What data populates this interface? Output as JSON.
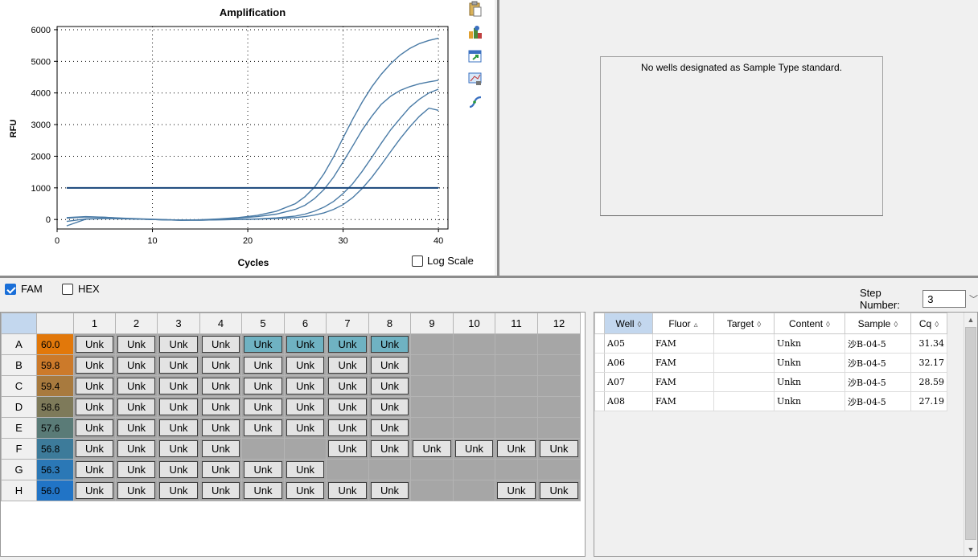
{
  "chart_data": {
    "type": "line",
    "title": "Amplification",
    "xlabel": "Cycles",
    "ylabel": "RFU",
    "xlim": [
      0,
      41
    ],
    "ylim": [
      -300,
      6100
    ],
    "xticks": [
      0,
      10,
      20,
      30,
      40
    ],
    "yticks": [
      0,
      1000,
      2000,
      3000,
      4000,
      5000,
      6000
    ],
    "threshold": 1000,
    "grid": "dotted",
    "x": [
      1,
      3,
      5,
      7,
      9,
      11,
      13,
      15,
      17,
      19,
      21,
      23,
      25,
      26,
      27,
      28,
      29,
      30,
      31,
      32,
      33,
      34,
      35,
      36,
      37,
      38,
      39,
      40
    ],
    "series": [
      {
        "well": "A05",
        "values": [
          -60,
          20,
          40,
          30,
          10,
          -10,
          -20,
          -20,
          -10,
          0,
          20,
          50,
          110,
          170,
          260,
          390,
          570,
          820,
          1130,
          1520,
          1960,
          2410,
          2840,
          3200,
          3550,
          3800,
          4000,
          4120
        ]
      },
      {
        "well": "A06",
        "values": [
          -200,
          10,
          30,
          20,
          10,
          -10,
          -20,
          -20,
          -10,
          0,
          10,
          30,
          60,
          90,
          140,
          210,
          320,
          470,
          690,
          980,
          1330,
          1730,
          2150,
          2560,
          2930,
          3260,
          3520,
          3450
        ]
      },
      {
        "well": "A07",
        "values": [
          40,
          80,
          70,
          40,
          20,
          0,
          -20,
          -10,
          10,
          40,
          90,
          170,
          320,
          450,
          660,
          950,
          1340,
          1820,
          2320,
          2830,
          3260,
          3640,
          3900,
          4080,
          4200,
          4290,
          4350,
          4400
        ]
      },
      {
        "well": "A08",
        "values": [
          60,
          90,
          70,
          30,
          10,
          -10,
          -20,
          -10,
          20,
          60,
          130,
          260,
          500,
          720,
          1020,
          1450,
          1980,
          2580,
          3170,
          3710,
          4190,
          4590,
          4930,
          5200,
          5410,
          5560,
          5660,
          5730
        ]
      }
    ],
    "line_color": "#4a7ba6",
    "threshold_color": "#17447a"
  },
  "toolbar": {
    "icons": [
      "clipboard-icon",
      "export-chart-icon",
      "export-data-icon",
      "chart-settings-icon",
      "curve-analysis-icon"
    ]
  },
  "std_curve": {
    "message": "No wells designated as Sample Type standard."
  },
  "log_scale_label": "Log Scale",
  "fluors": [
    {
      "label": "FAM",
      "checked": true
    },
    {
      "label": "HEX",
      "checked": false
    }
  ],
  "step": {
    "label": "Step Number:",
    "value": "3"
  },
  "plate": {
    "columns": [
      "1",
      "2",
      "3",
      "4",
      "5",
      "6",
      "7",
      "8",
      "9",
      "10",
      "11",
      "12"
    ],
    "rows": [
      {
        "label": "A",
        "temp": "60.0",
        "temp_color": "#e2780a",
        "wells": [
          "Unk",
          "Unk",
          "Unk",
          "Unk",
          "Unk*",
          "Unk*",
          "Unk*",
          "Unk*",
          "",
          "",
          "",
          ""
        ]
      },
      {
        "label": "B",
        "temp": "59.8",
        "temp_color": "#cc7a2a",
        "wells": [
          "Unk",
          "Unk",
          "Unk",
          "Unk",
          "Unk",
          "Unk",
          "Unk",
          "Unk",
          "",
          "",
          "",
          ""
        ]
      },
      {
        "label": "C",
        "temp": "59.4",
        "temp_color": "#a87a3e",
        "wells": [
          "Unk",
          "Unk",
          "Unk",
          "Unk",
          "Unk",
          "Unk",
          "Unk",
          "Unk",
          "",
          "",
          "",
          ""
        ]
      },
      {
        "label": "D",
        "temp": "58.6",
        "temp_color": "#7e7a5a",
        "wells": [
          "Unk",
          "Unk",
          "Unk",
          "Unk",
          "Unk",
          "Unk",
          "Unk",
          "Unk",
          "",
          "",
          "",
          ""
        ]
      },
      {
        "label": "E",
        "temp": "57.6",
        "temp_color": "#5a7b77",
        "wells": [
          "Unk",
          "Unk",
          "Unk",
          "Unk",
          "Unk",
          "Unk",
          "Unk",
          "Unk",
          "",
          "",
          "",
          ""
        ]
      },
      {
        "label": "F",
        "temp": "56.8",
        "temp_color": "#3d7b9a",
        "wells": [
          "Unk",
          "Unk",
          "Unk",
          "Unk",
          "",
          "",
          "Unk",
          "Unk",
          "Unk",
          "Unk",
          "Unk",
          "Unk"
        ]
      },
      {
        "label": "G",
        "temp": "56.3",
        "temp_color": "#2b78b6",
        "wells": [
          "Unk",
          "Unk",
          "Unk",
          "Unk",
          "Unk",
          "Unk",
          "",
          "",
          "",
          "",
          "",
          ""
        ]
      },
      {
        "label": "H",
        "temp": "56.0",
        "temp_color": "#2174c6",
        "wells": [
          "Unk",
          "Unk",
          "Unk",
          "Unk",
          "Unk",
          "Unk",
          "Unk",
          "Unk",
          "",
          "",
          "Unk",
          "Unk"
        ]
      }
    ]
  },
  "results": {
    "columns": [
      "Well",
      "Fluor",
      "Target",
      "Content",
      "Sample",
      "Cq"
    ],
    "rows": [
      {
        "well": "A05",
        "fluor": "FAM",
        "target": "",
        "content": "Unkn",
        "sample": "沙B-04-5",
        "cq": "31.34"
      },
      {
        "well": "A06",
        "fluor": "FAM",
        "target": "",
        "content": "Unkn",
        "sample": "沙B-04-5",
        "cq": "32.17"
      },
      {
        "well": "A07",
        "fluor": "FAM",
        "target": "",
        "content": "Unkn",
        "sample": "沙B-04-5",
        "cq": "28.59"
      },
      {
        "well": "A08",
        "fluor": "FAM",
        "target": "",
        "content": "Unkn",
        "sample": "沙B-04-5",
        "cq": "27.19"
      }
    ]
  }
}
